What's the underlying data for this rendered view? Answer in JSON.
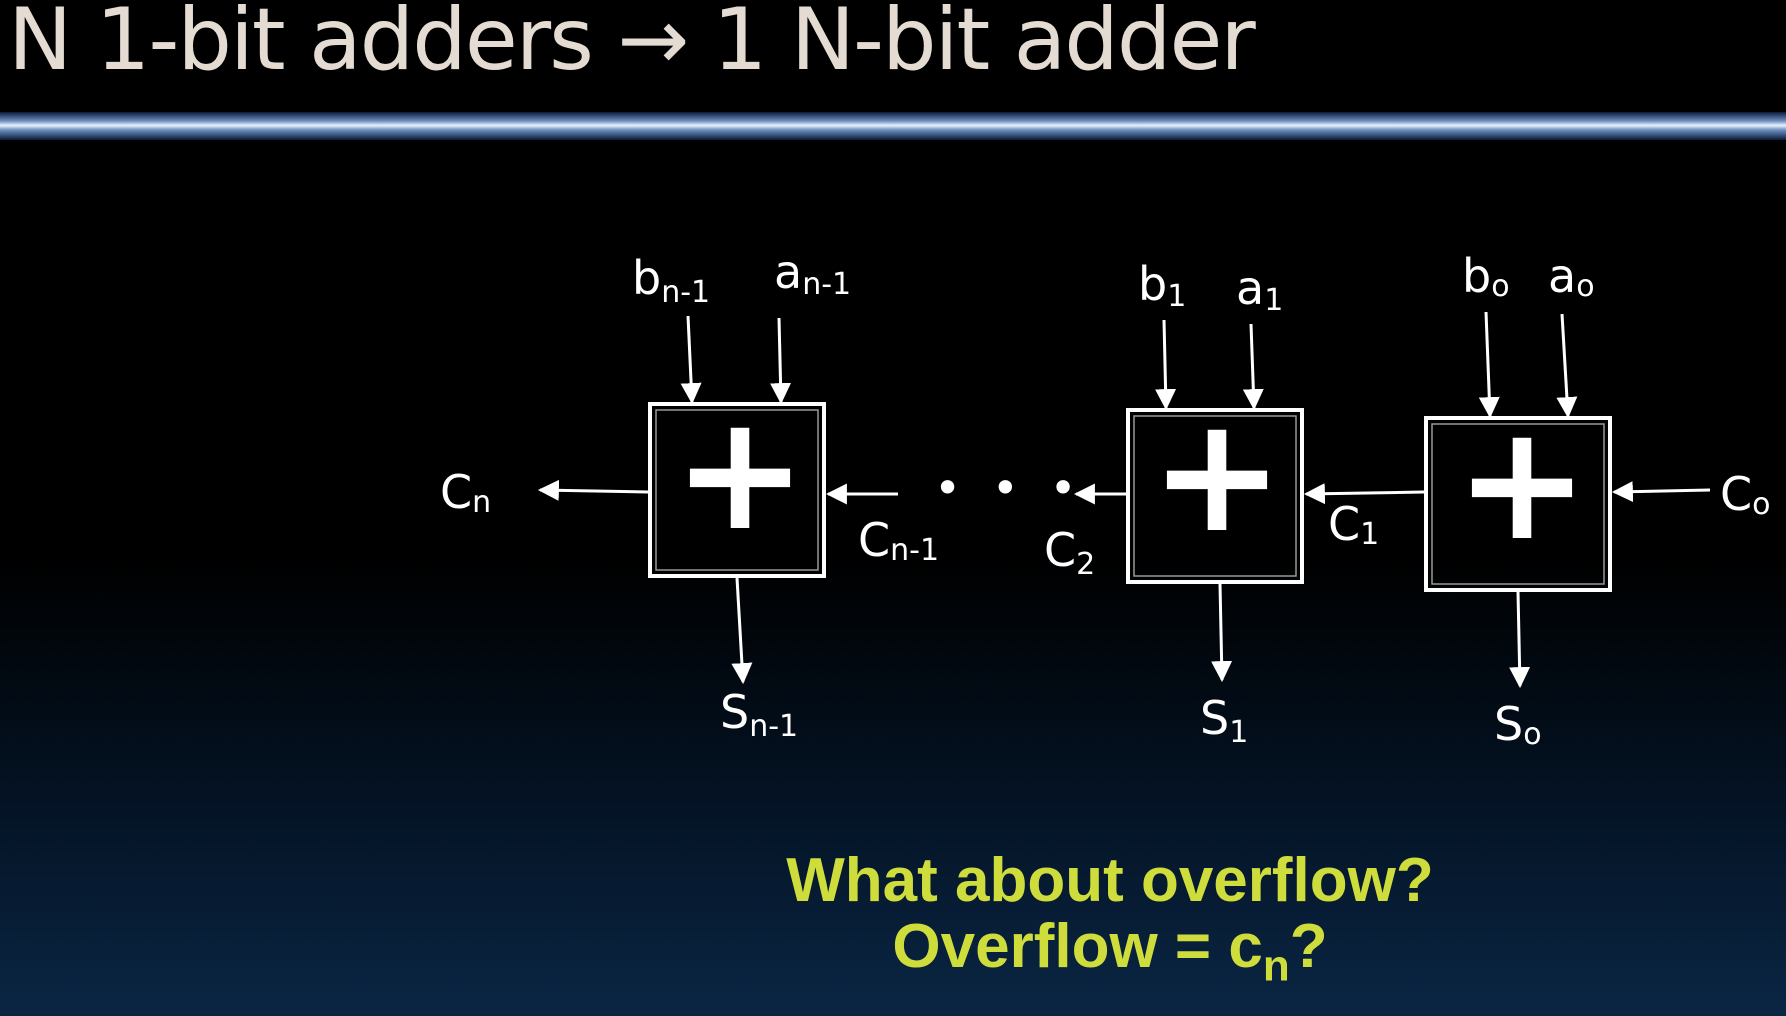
{
  "slide": {
    "title": "N 1-bit adders → 1 N-bit adder",
    "question_line1": "What about overflow?",
    "question_line2_prefix": "Overflow = c",
    "question_line2_sub": "n",
    "question_line2_suffix": "?",
    "colors": {
      "title": "#e4dcd2",
      "question": "#cfdd3c",
      "drawing": "#ffffff",
      "background_top": "#000000",
      "background_bottom": "#0a2644"
    }
  },
  "adders": [
    {
      "symbol": "+",
      "input_b": {
        "base": "b",
        "sub": "n-1"
      },
      "input_a": {
        "base": "a",
        "sub": "n-1"
      },
      "sum": {
        "base": "S",
        "sub": "n-1"
      }
    },
    {
      "symbol": "+",
      "input_b": {
        "base": "b",
        "sub": "1"
      },
      "input_a": {
        "base": "a",
        "sub": "1"
      },
      "sum": {
        "base": "S",
        "sub": "1"
      }
    },
    {
      "symbol": "+",
      "input_b": {
        "base": "b",
        "sub": "o"
      },
      "input_a": {
        "base": "a",
        "sub": "o"
      },
      "sum": {
        "base": "S",
        "sub": "o"
      }
    }
  ],
  "carries": {
    "c_n": {
      "base": "C",
      "sub": "n"
    },
    "c_n_minus_1": {
      "base": "C",
      "sub": "n-1"
    },
    "c_2": {
      "base": "C",
      "sub": "2"
    },
    "c_1": {
      "base": "C",
      "sub": "1"
    },
    "c_0": {
      "base": "C",
      "sub": "o"
    }
  },
  "ellipsis": "• • •"
}
